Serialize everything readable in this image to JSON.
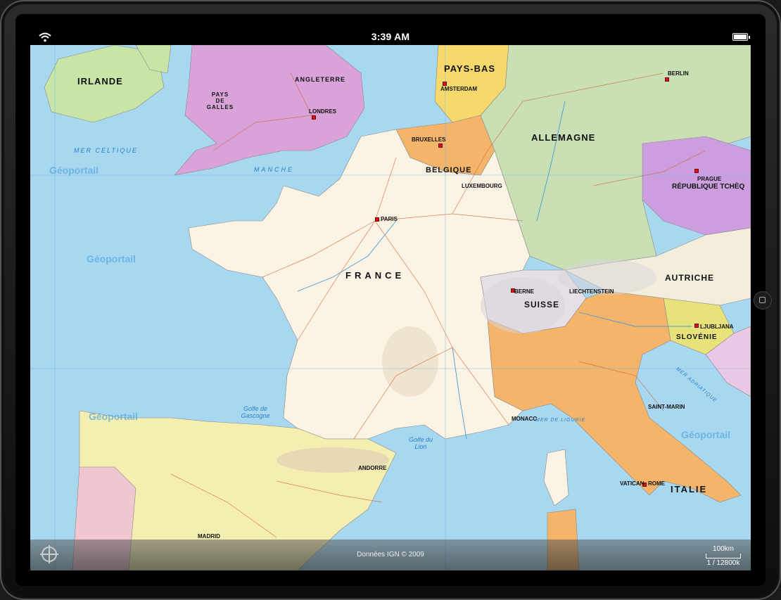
{
  "status": {
    "time": "3:39 AM"
  },
  "map": {
    "countries": [
      {
        "name": "IRLANDE"
      },
      {
        "name": "PAYS-BAS"
      },
      {
        "name": "ALLEMAGNE"
      },
      {
        "name": "BELGIQUE"
      },
      {
        "name": "FRANCE"
      },
      {
        "name": "SUISSE"
      },
      {
        "name": "AUTRICHE"
      },
      {
        "name": "ITALIE"
      },
      {
        "name": "SLOVÉNIE"
      },
      {
        "name": "RÉPUBLIQUE TCHÈQ"
      },
      {
        "name": "ANGLETERRE"
      },
      {
        "name": "PAYS DE GALLES"
      },
      {
        "name": "LUXEMBOURG"
      },
      {
        "name": "LIECHTENSTEIN"
      },
      {
        "name": "MONACO"
      },
      {
        "name": "ANDORRE"
      }
    ],
    "cities": [
      {
        "name": "PARIS"
      },
      {
        "name": "LONDRES"
      },
      {
        "name": "BRUXELLES"
      },
      {
        "name": "BERLIN"
      },
      {
        "name": "PRAGUE"
      },
      {
        "name": "BERNE"
      },
      {
        "name": "ROME"
      },
      {
        "name": "MADRID"
      },
      {
        "name": "VATICAN"
      },
      {
        "name": "SAINT-MARIN"
      },
      {
        "name": "LJUBLJANA"
      },
      {
        "name": "AMSTERDAM"
      }
    ],
    "seas": [
      {
        "name": "MER CELTIQUE"
      },
      {
        "name": "MANCHE"
      },
      {
        "name": "MER DE LIGURIE"
      },
      {
        "name": "Golfe de Gascogne"
      },
      {
        "name": "Golfe du Lion"
      },
      {
        "name": "MER ADRIATIQUE"
      }
    ],
    "watermark": "Géoportail",
    "colors": {
      "sea": "#a8d8f0",
      "france": "#fbf3e3",
      "germany": "#c8e0b4",
      "uk": "#d9a2d8",
      "spain": "#f5eeb1",
      "italy": "#f4b46a"
    }
  },
  "footer": {
    "credits": "Données IGN © 2009",
    "scale_distance": "100km",
    "scale_ratio": "1 / 12800k"
  }
}
